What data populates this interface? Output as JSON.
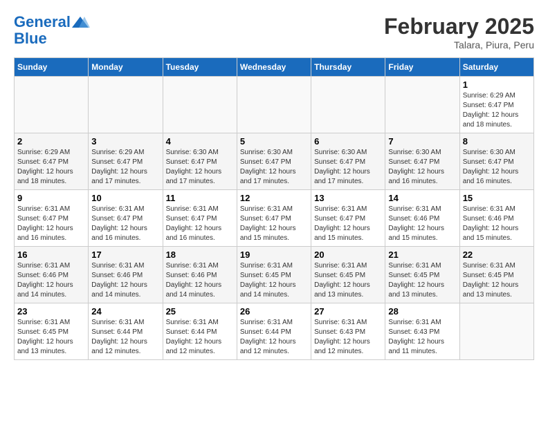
{
  "header": {
    "logo_line1": "General",
    "logo_line2": "Blue",
    "month": "February 2025",
    "location": "Talara, Piura, Peru"
  },
  "weekdays": [
    "Sunday",
    "Monday",
    "Tuesday",
    "Wednesday",
    "Thursday",
    "Friday",
    "Saturday"
  ],
  "weeks": [
    [
      {
        "day": "",
        "empty": true
      },
      {
        "day": "",
        "empty": true
      },
      {
        "day": "",
        "empty": true
      },
      {
        "day": "",
        "empty": true
      },
      {
        "day": "",
        "empty": true
      },
      {
        "day": "",
        "empty": true
      },
      {
        "day": "1",
        "sunrise": "6:29 AM",
        "sunset": "6:47 PM",
        "daylight": "12 hours and 18 minutes."
      }
    ],
    [
      {
        "day": "2",
        "sunrise": "6:29 AM",
        "sunset": "6:47 PM",
        "daylight": "12 hours and 18 minutes."
      },
      {
        "day": "3",
        "sunrise": "6:29 AM",
        "sunset": "6:47 PM",
        "daylight": "12 hours and 17 minutes."
      },
      {
        "day": "4",
        "sunrise": "6:30 AM",
        "sunset": "6:47 PM",
        "daylight": "12 hours and 17 minutes."
      },
      {
        "day": "5",
        "sunrise": "6:30 AM",
        "sunset": "6:47 PM",
        "daylight": "12 hours and 17 minutes."
      },
      {
        "day": "6",
        "sunrise": "6:30 AM",
        "sunset": "6:47 PM",
        "daylight": "12 hours and 17 minutes."
      },
      {
        "day": "7",
        "sunrise": "6:30 AM",
        "sunset": "6:47 PM",
        "daylight": "12 hours and 16 minutes."
      },
      {
        "day": "8",
        "sunrise": "6:30 AM",
        "sunset": "6:47 PM",
        "daylight": "12 hours and 16 minutes."
      }
    ],
    [
      {
        "day": "9",
        "sunrise": "6:31 AM",
        "sunset": "6:47 PM",
        "daylight": "12 hours and 16 minutes."
      },
      {
        "day": "10",
        "sunrise": "6:31 AM",
        "sunset": "6:47 PM",
        "daylight": "12 hours and 16 minutes."
      },
      {
        "day": "11",
        "sunrise": "6:31 AM",
        "sunset": "6:47 PM",
        "daylight": "12 hours and 16 minutes."
      },
      {
        "day": "12",
        "sunrise": "6:31 AM",
        "sunset": "6:47 PM",
        "daylight": "12 hours and 15 minutes."
      },
      {
        "day": "13",
        "sunrise": "6:31 AM",
        "sunset": "6:47 PM",
        "daylight": "12 hours and 15 minutes."
      },
      {
        "day": "14",
        "sunrise": "6:31 AM",
        "sunset": "6:46 PM",
        "daylight": "12 hours and 15 minutes."
      },
      {
        "day": "15",
        "sunrise": "6:31 AM",
        "sunset": "6:46 PM",
        "daylight": "12 hours and 15 minutes."
      }
    ],
    [
      {
        "day": "16",
        "sunrise": "6:31 AM",
        "sunset": "6:46 PM",
        "daylight": "12 hours and 14 minutes."
      },
      {
        "day": "17",
        "sunrise": "6:31 AM",
        "sunset": "6:46 PM",
        "daylight": "12 hours and 14 minutes."
      },
      {
        "day": "18",
        "sunrise": "6:31 AM",
        "sunset": "6:46 PM",
        "daylight": "12 hours and 14 minutes."
      },
      {
        "day": "19",
        "sunrise": "6:31 AM",
        "sunset": "6:45 PM",
        "daylight": "12 hours and 14 minutes."
      },
      {
        "day": "20",
        "sunrise": "6:31 AM",
        "sunset": "6:45 PM",
        "daylight": "12 hours and 13 minutes."
      },
      {
        "day": "21",
        "sunrise": "6:31 AM",
        "sunset": "6:45 PM",
        "daylight": "12 hours and 13 minutes."
      },
      {
        "day": "22",
        "sunrise": "6:31 AM",
        "sunset": "6:45 PM",
        "daylight": "12 hours and 13 minutes."
      }
    ],
    [
      {
        "day": "23",
        "sunrise": "6:31 AM",
        "sunset": "6:45 PM",
        "daylight": "12 hours and 13 minutes."
      },
      {
        "day": "24",
        "sunrise": "6:31 AM",
        "sunset": "6:44 PM",
        "daylight": "12 hours and 12 minutes."
      },
      {
        "day": "25",
        "sunrise": "6:31 AM",
        "sunset": "6:44 PM",
        "daylight": "12 hours and 12 minutes."
      },
      {
        "day": "26",
        "sunrise": "6:31 AM",
        "sunset": "6:44 PM",
        "daylight": "12 hours and 12 minutes."
      },
      {
        "day": "27",
        "sunrise": "6:31 AM",
        "sunset": "6:43 PM",
        "daylight": "12 hours and 12 minutes."
      },
      {
        "day": "28",
        "sunrise": "6:31 AM",
        "sunset": "6:43 PM",
        "daylight": "12 hours and 11 minutes."
      },
      {
        "day": "",
        "empty": true
      }
    ]
  ]
}
